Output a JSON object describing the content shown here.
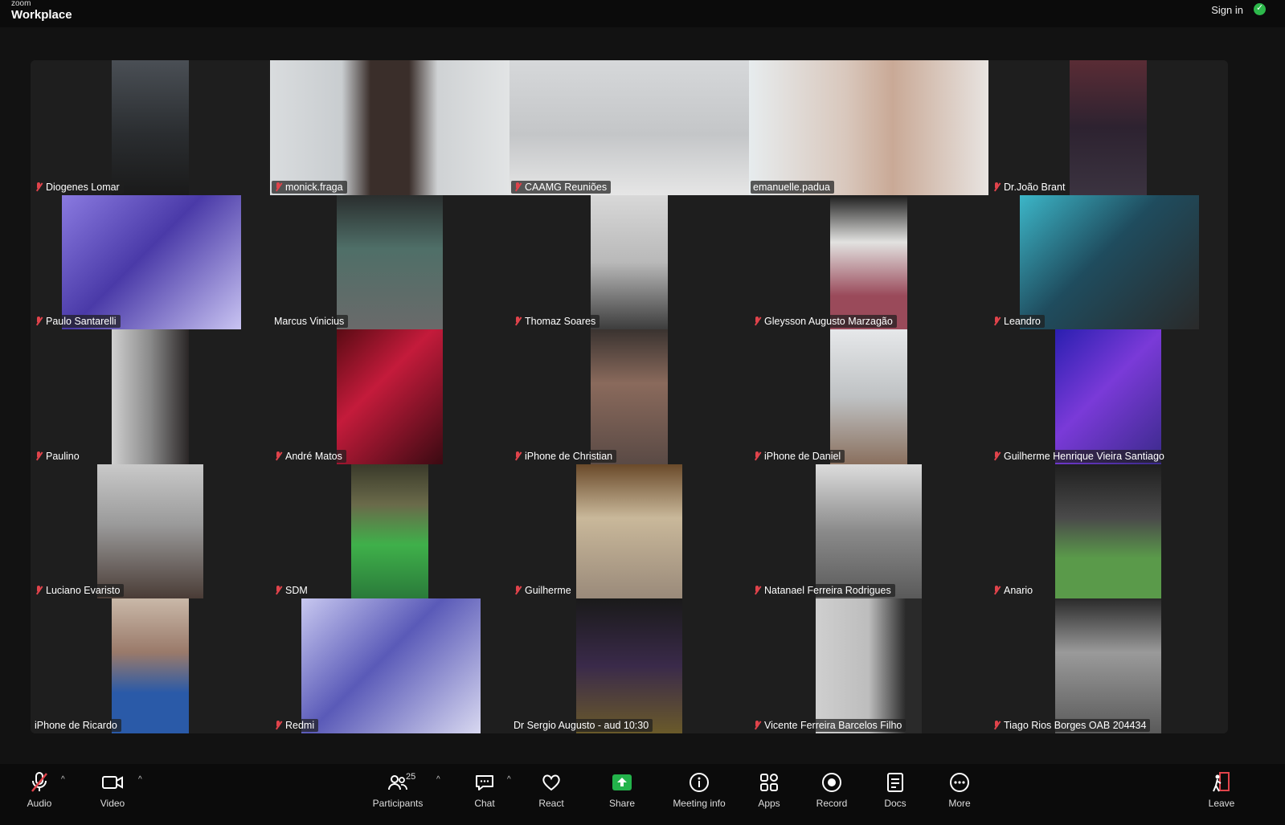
{
  "app": {
    "brand_small": "zoom",
    "brand_large": "Workplace",
    "sign_in": "Sign in"
  },
  "colors": {
    "active_speaker": "#23d18b",
    "muted": "#e0434b",
    "share": "#23b34b"
  },
  "participants": [
    {
      "name": "Diogenes Lomar",
      "muted": true
    },
    {
      "name": "monick.fraga",
      "muted": true
    },
    {
      "name": "CAAMG Reuniões",
      "muted": true
    },
    {
      "name": "emanuelle.padua",
      "muted": false
    },
    {
      "name": "Dr.João Brant",
      "muted": true
    },
    {
      "name": "Paulo Santarelli",
      "muted": true
    },
    {
      "name": "Marcus Vinicius",
      "muted": false
    },
    {
      "name": "Thomaz Soares",
      "muted": true
    },
    {
      "name": "Gleysson Augusto Marzagão",
      "muted": true
    },
    {
      "name": "Leandro",
      "muted": true
    },
    {
      "name": "Paulino",
      "muted": true
    },
    {
      "name": "André Matos",
      "muted": true
    },
    {
      "name": "iPhone de Christian",
      "muted": true
    },
    {
      "name": "iPhone de Daniel",
      "muted": true
    },
    {
      "name": "Guilherme Henrique Vieira Santiago",
      "muted": true
    },
    {
      "name": "Luciano Evaristo",
      "muted": true
    },
    {
      "name": "SDM",
      "muted": true
    },
    {
      "name": "Guilherme",
      "muted": true
    },
    {
      "name": "Natanael Ferreira Rodrigues",
      "muted": true
    },
    {
      "name": "Anario",
      "muted": true
    },
    {
      "name": "iPhone de Ricardo",
      "muted": false
    },
    {
      "name": "Redmi",
      "muted": true
    },
    {
      "name": "Dr Sergio Augusto - aud 10:30",
      "muted": false
    },
    {
      "name": "Vicente Ferreira Barcelos Filho",
      "muted": true
    },
    {
      "name": "Tiago Rios Borges OAB 204434",
      "muted": true
    }
  ],
  "toolbar": {
    "audio": "Audio",
    "video": "Video",
    "participants": "Participants",
    "participants_count": "25",
    "chat": "Chat",
    "react": "React",
    "share": "Share",
    "meeting_info": "Meeting info",
    "apps": "Apps",
    "record": "Record",
    "docs": "Docs",
    "more": "More",
    "leave": "Leave"
  }
}
